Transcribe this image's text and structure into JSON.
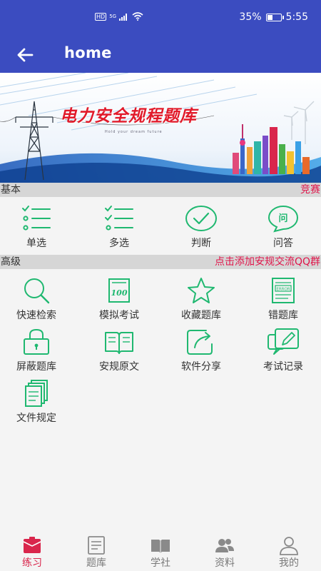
{
  "status_bar": {
    "network": "HD",
    "signal_label": "5G",
    "battery_percent": "35%",
    "battery_level": 0.35,
    "time": "5:55"
  },
  "app_bar": {
    "title": "home"
  },
  "banner": {
    "title": "电力安全规程题库",
    "subtitle": "Hold your dream future"
  },
  "basic_section": {
    "title": "基本",
    "action": "竞赛",
    "items": [
      {
        "label": "单选",
        "icon": "single-choice-icon"
      },
      {
        "label": "多选",
        "icon": "multi-choice-icon"
      },
      {
        "label": "判断",
        "icon": "check-icon"
      },
      {
        "label": "问答",
        "icon": "qa-bubble-icon"
      }
    ]
  },
  "advanced_section": {
    "title": "高级",
    "action": "点击添加安规交流QQ群",
    "items": [
      {
        "label": "快速检索",
        "icon": "search-icon"
      },
      {
        "label": "模拟考试",
        "icon": "exam-100-icon"
      },
      {
        "label": "收藏题库",
        "icon": "star-icon"
      },
      {
        "label": "错题库",
        "icon": "error-doc-icon"
      },
      {
        "label": "屏蔽题库",
        "icon": "lock-icon"
      },
      {
        "label": "安规原文",
        "icon": "book-icon"
      },
      {
        "label": "软件分享",
        "icon": "share-icon"
      },
      {
        "label": "考试记录",
        "icon": "edit-note-icon"
      },
      {
        "label": "文件规定",
        "icon": "documents-icon"
      }
    ]
  },
  "tab_bar": {
    "active_index": 0,
    "tabs": [
      {
        "label": "练习",
        "icon": "practice-icon"
      },
      {
        "label": "题库",
        "icon": "question-bank-icon"
      },
      {
        "label": "学社",
        "icon": "study-icon"
      },
      {
        "label": "资料",
        "icon": "materials-icon"
      },
      {
        "label": "我的",
        "icon": "profile-icon"
      }
    ]
  },
  "colors": {
    "primary": "#3b4cc0",
    "accent_green": "#1fb870",
    "accent_pink": "#e0154a",
    "active_tab": "#d9264c"
  }
}
